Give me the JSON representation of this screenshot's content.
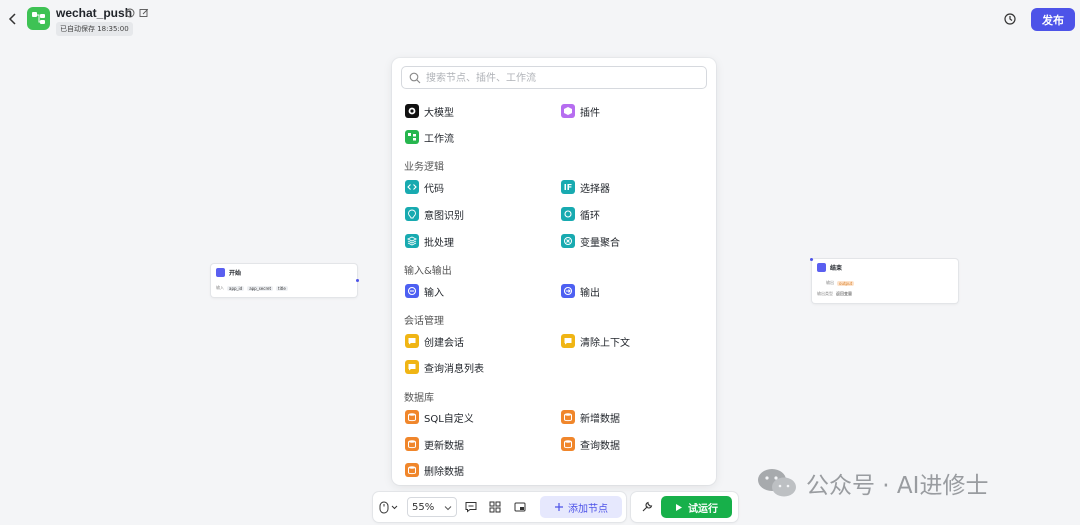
{
  "header": {
    "title": "wechat_push",
    "saved_status": "已自动保存 18:35:00",
    "publish_label": "发布",
    "colors": {
      "app_icon": "#3ec254",
      "publish": "#4d53e8"
    }
  },
  "canvas": {
    "start_node": {
      "title": "开始",
      "row_label": "输入",
      "params": [
        "app_id",
        "app_secret",
        "title"
      ]
    },
    "end_node": {
      "title": "结束",
      "output_label": "输出",
      "output_value": "output",
      "type_label": "输出类型",
      "type_value": "返回变量"
    }
  },
  "node_menu": {
    "search_placeholder": "搜索节点、插件、工作流",
    "top_items": [
      {
        "label": "大模型",
        "icon": "llm-icon",
        "color": "#111111"
      },
      {
        "label": "插件",
        "icon": "plugin-icon",
        "color": "#b66df0"
      },
      {
        "label": "工作流",
        "icon": "workflow-icon",
        "color": "#26b64e"
      }
    ],
    "sections": [
      {
        "title": "业务逻辑",
        "items": [
          {
            "label": "代码",
            "icon": "code-icon"
          },
          {
            "label": "选择器",
            "icon": "if-icon"
          },
          {
            "label": "意图识别",
            "icon": "intent-icon"
          },
          {
            "label": "循环",
            "icon": "loop-icon"
          },
          {
            "label": "批处理",
            "icon": "batch-icon"
          },
          {
            "label": "变量聚合",
            "icon": "variable-merge-icon"
          }
        ]
      },
      {
        "title": "输入&输出",
        "items": [
          {
            "label": "输入",
            "icon": "input-icon"
          },
          {
            "label": "输出",
            "icon": "output-icon"
          }
        ]
      },
      {
        "title": "会话管理",
        "items": [
          {
            "label": "创建会话",
            "icon": "create-session-icon"
          },
          {
            "label": "清除上下文",
            "icon": "clear-context-icon"
          },
          {
            "label": "查询消息列表",
            "icon": "message-list-icon"
          }
        ]
      },
      {
        "title": "数据库",
        "items": [
          {
            "label": "SQL自定义",
            "icon": "sql-icon"
          },
          {
            "label": "新增数据",
            "icon": "insert-data-icon"
          },
          {
            "label": "更新数据",
            "icon": "update-data-icon"
          },
          {
            "label": "查询数据",
            "icon": "query-data-icon"
          },
          {
            "label": "删除数据",
            "icon": "delete-data-icon"
          }
        ]
      }
    ]
  },
  "toolbar": {
    "zoom": "55%",
    "add_node_label": "添加节点",
    "run_label": "试运行"
  },
  "watermark": {
    "text": "公众号 · AI进修士"
  }
}
